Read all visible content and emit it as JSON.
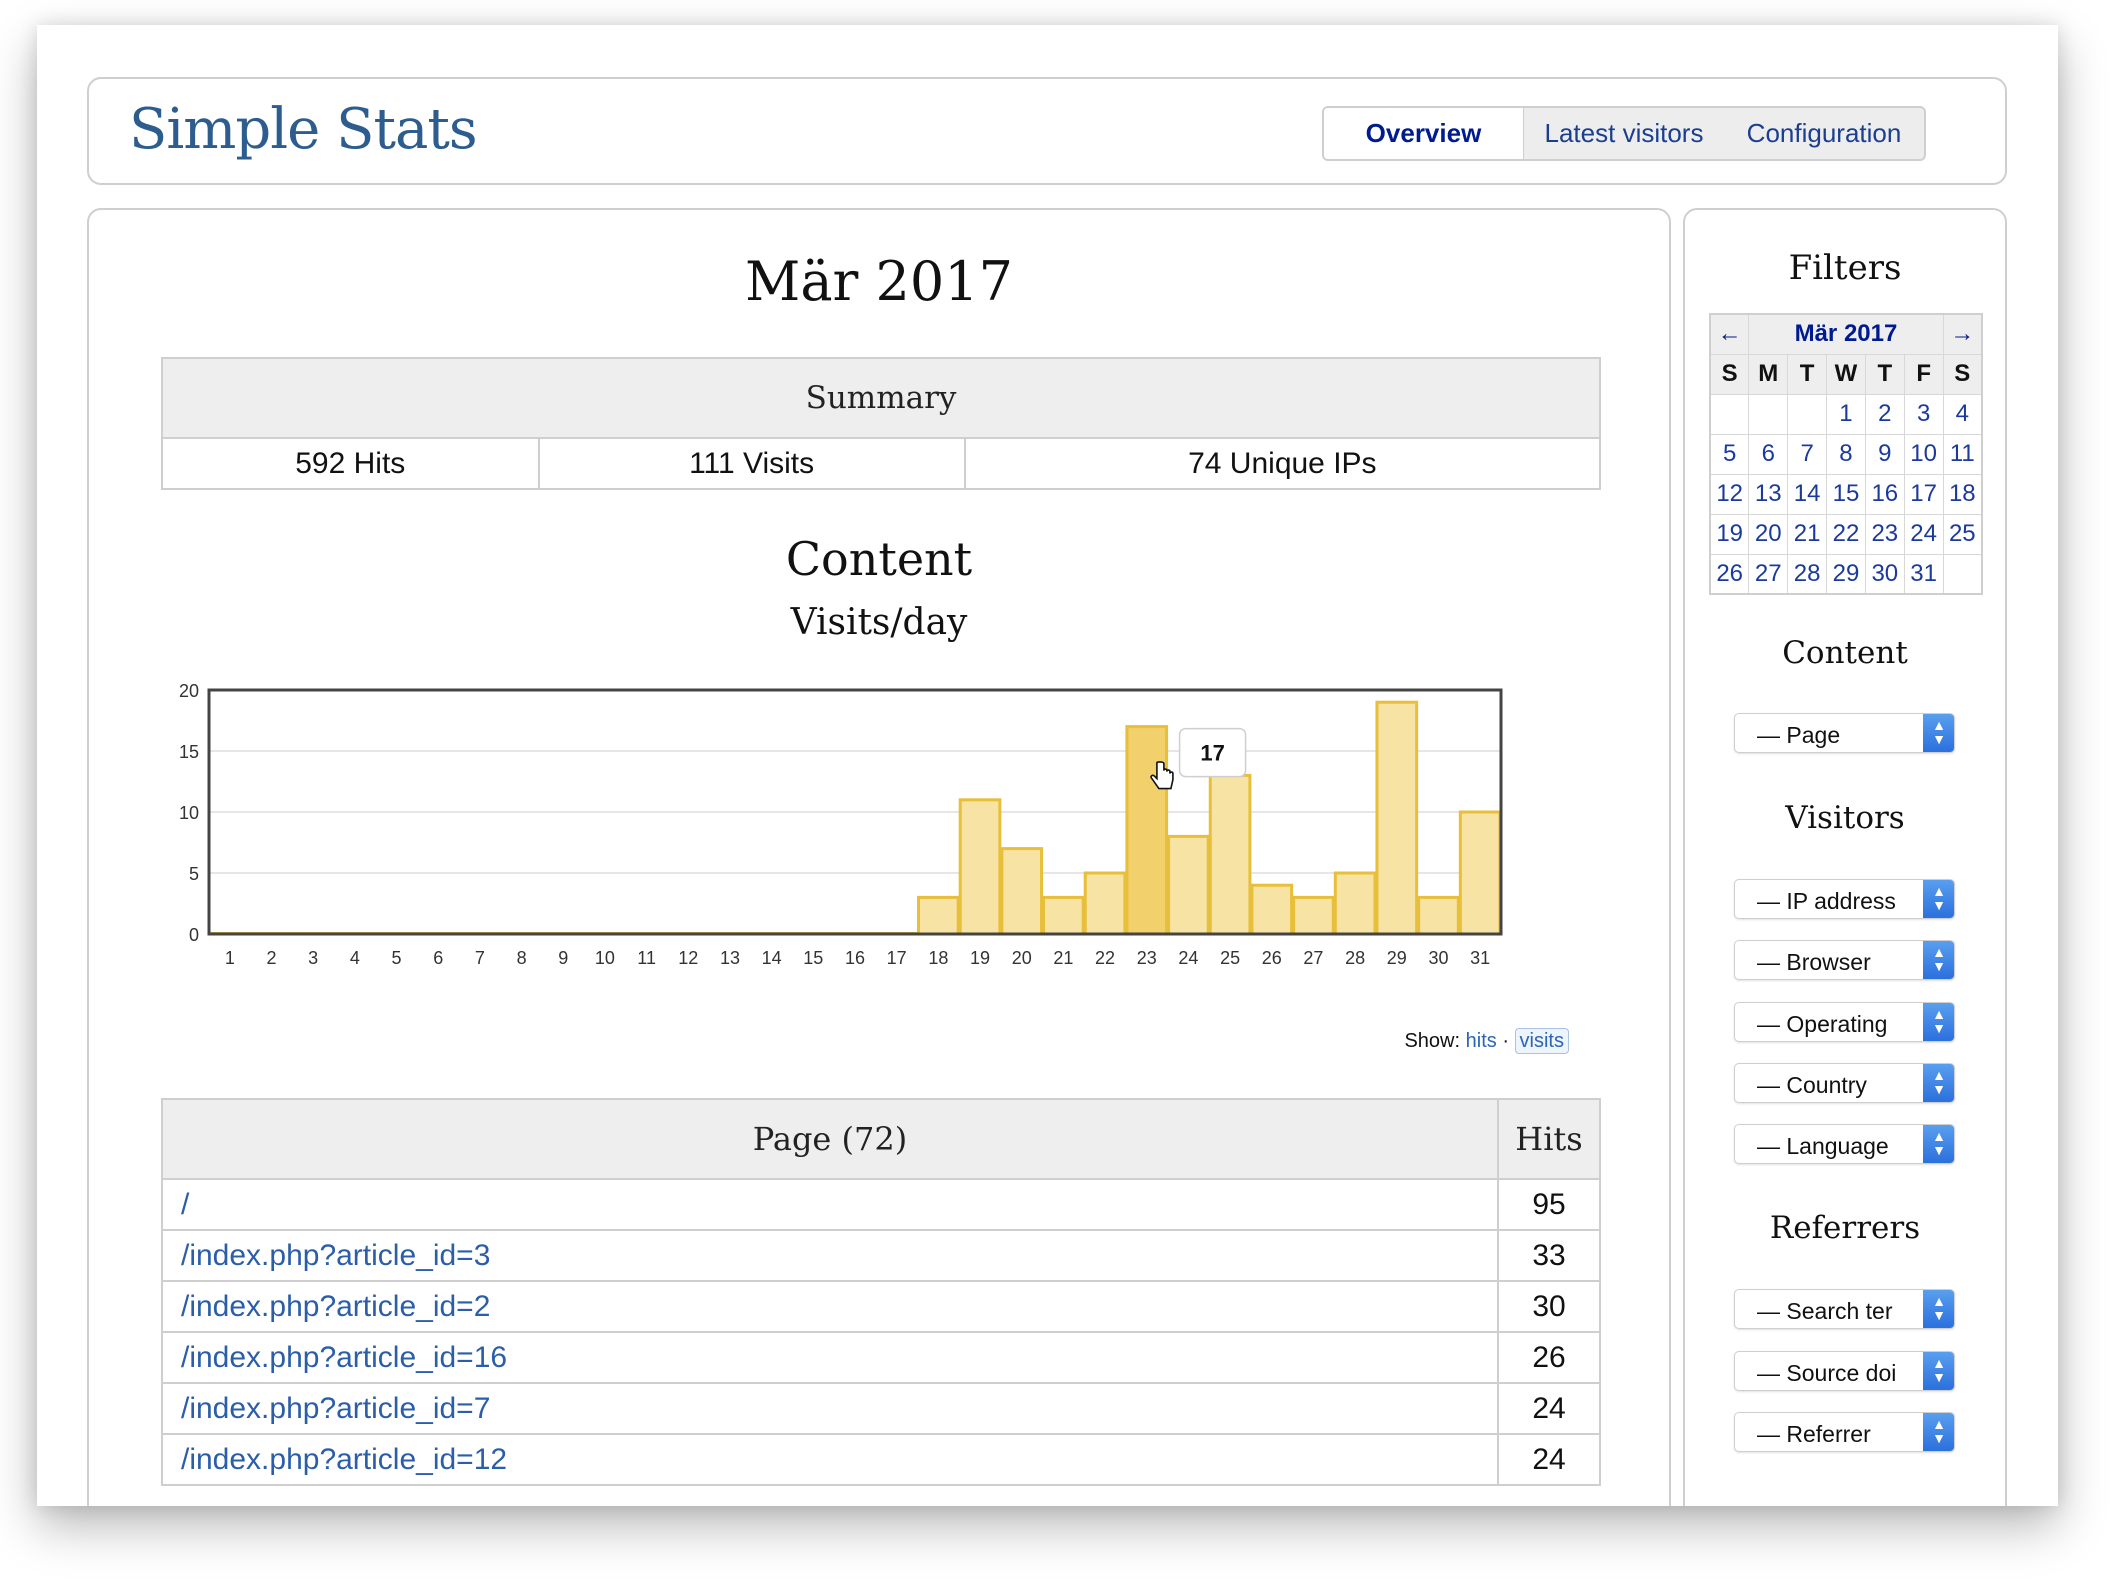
{
  "app": {
    "title": "Simple Stats"
  },
  "nav": {
    "tabs": [
      {
        "label": "Overview",
        "active": true
      },
      {
        "label": "Latest visitors",
        "active": false
      },
      {
        "label": "Configuration",
        "active": false
      }
    ]
  },
  "main": {
    "month_title": "Mär 2017",
    "summary": {
      "header": "Summary",
      "hits": "592 Hits",
      "visits": "111 Visits",
      "unique_ips": "74 Unique IPs"
    },
    "content_title": "Content",
    "chart_title": "Visits/day",
    "tooltip": {
      "value": "17",
      "day": 23
    },
    "show": {
      "label": "Show:",
      "hits": "hits",
      "sep": "·",
      "visits": "visits",
      "selected": "visits"
    },
    "table": {
      "header_page": "Page (72)",
      "header_hits": "Hits",
      "rows": [
        {
          "page": "/",
          "hits": "95"
        },
        {
          "page": "/index.php?article_id=3",
          "hits": "33"
        },
        {
          "page": "/index.php?article_id=2",
          "hits": "30"
        },
        {
          "page": "/index.php?article_id=16",
          "hits": "26"
        },
        {
          "page": "/index.php?article_id=7",
          "hits": "24"
        },
        {
          "page": "/index.php?article_id=12",
          "hits": "24"
        }
      ]
    }
  },
  "chart_data": {
    "type": "bar",
    "title": "Visits/day",
    "xlabel": "",
    "ylabel": "",
    "categories": [
      "1",
      "2",
      "3",
      "4",
      "5",
      "6",
      "7",
      "8",
      "9",
      "10",
      "11",
      "12",
      "13",
      "14",
      "15",
      "16",
      "17",
      "18",
      "19",
      "20",
      "21",
      "22",
      "23",
      "24",
      "25",
      "26",
      "27",
      "28",
      "29",
      "30",
      "31"
    ],
    "values": [
      0,
      0,
      0,
      0,
      0,
      0,
      0,
      0,
      0,
      0,
      0,
      0,
      0,
      0,
      0,
      0,
      0,
      3,
      11,
      7,
      3,
      5,
      17,
      8,
      13,
      4,
      3,
      5,
      19,
      3,
      10
    ],
    "yticks": [
      "0",
      "5",
      "10",
      "15",
      "20"
    ],
    "ylim": [
      0,
      20
    ],
    "highlight_index": 22,
    "colors": {
      "fill": "#f7e3a3",
      "stroke": "#e8bf3a",
      "highlight": "#f2d06b",
      "frame": "#444444",
      "grid": "#dddddd"
    }
  },
  "sidebar": {
    "filters_title": "Filters",
    "calendar": {
      "prev": "←",
      "next": "→",
      "month": "Mär 2017",
      "dows": [
        "S",
        "M",
        "T",
        "W",
        "T",
        "F",
        "S"
      ],
      "weeks": [
        [
          "",
          "",
          "",
          "1",
          "2",
          "3",
          "4"
        ],
        [
          "5",
          "6",
          "7",
          "8",
          "9",
          "10",
          "11"
        ],
        [
          "12",
          "13",
          "14",
          "15",
          "16",
          "17",
          "18"
        ],
        [
          "19",
          "20",
          "21",
          "22",
          "23",
          "24",
          "25"
        ],
        [
          "26",
          "27",
          "28",
          "29",
          "30",
          "31",
          ""
        ]
      ]
    },
    "content_title": "Content",
    "content_select": "— Page",
    "visitors_title": "Visitors",
    "visitor_selects": [
      "— IP address",
      "— Browser",
      "— Operating",
      "— Country",
      "— Language"
    ],
    "referrers_title": "Referrers",
    "referrer_selects": [
      "— Search ter",
      "— Source doi",
      "— Referrer"
    ]
  }
}
